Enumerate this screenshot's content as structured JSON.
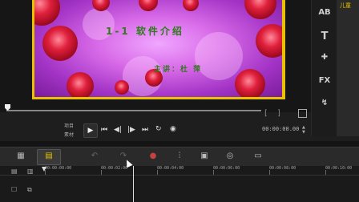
{
  "preview": {
    "title": "1-1 软件介绍",
    "subtitle": "主讲：杜 萍"
  },
  "right_toolbar": {
    "top_label": "儿童",
    "tools": [
      {
        "name": "media-icon",
        "glyph": "AB"
      },
      {
        "name": "title-icon",
        "glyph": "T"
      },
      {
        "name": "transition-icon",
        "glyph": "✚"
      },
      {
        "name": "fx-icon",
        "glyph": "FX"
      },
      {
        "name": "path-icon",
        "glyph": "↯"
      }
    ]
  },
  "transport": {
    "project_label": "项目",
    "clip_label": "素材",
    "play": "▶",
    "home": "⏮",
    "prev": "◀|",
    "next": "|▶",
    "end": "⏭",
    "repeat": "↻",
    "volume": "◉",
    "timecode": "00:00:00.00",
    "bracket_in": "[",
    "bracket_out": "]"
  },
  "timeline": {
    "ruler_labels": [
      "00:00:00:00",
      "00:00:02:00",
      "00:00:04:00",
      "00:00:06:00",
      "00:00:08:00",
      "00:00:10:00"
    ]
  },
  "colors": {
    "frame": "#e8c200",
    "title_text": "#2e7a1a"
  }
}
